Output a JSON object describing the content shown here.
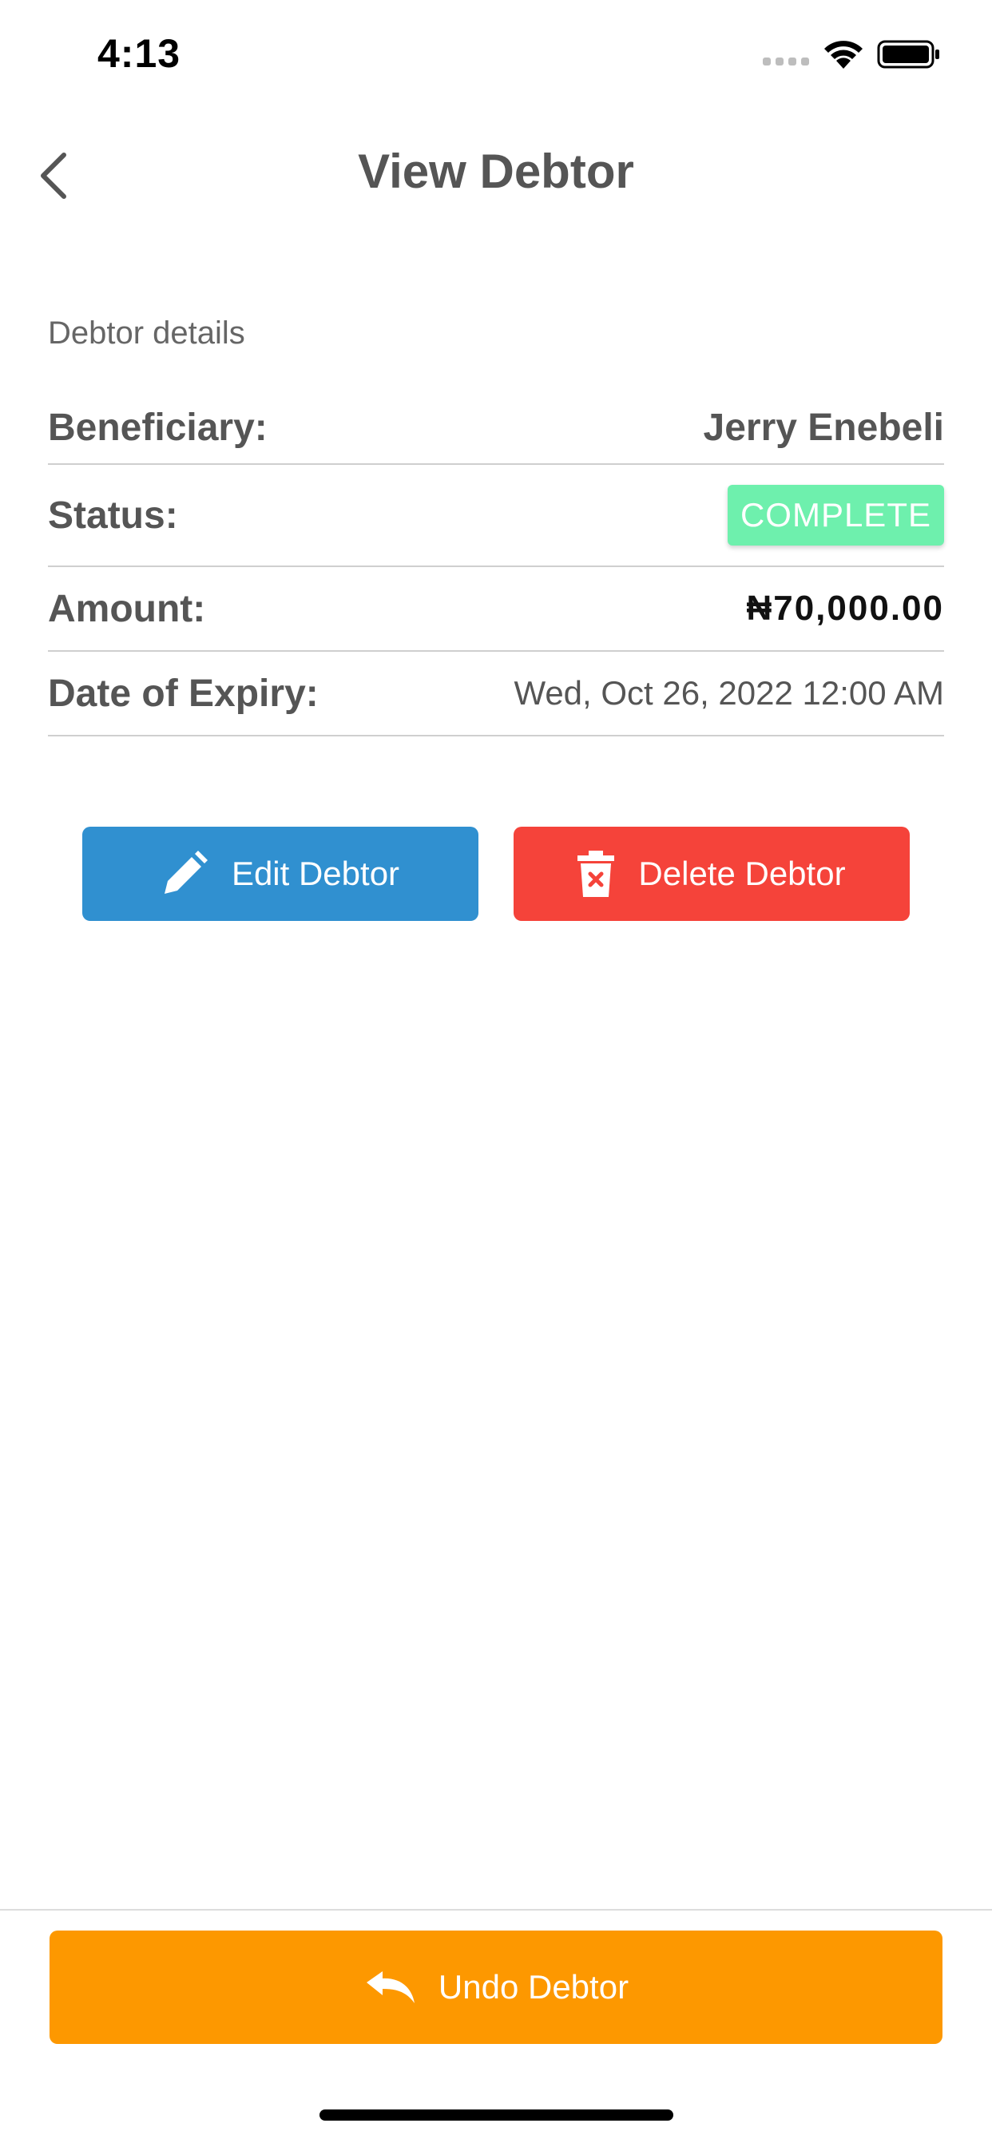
{
  "status_bar": {
    "time": "4:13"
  },
  "header": {
    "title": "View Debtor"
  },
  "details": {
    "section_label": "Debtor details",
    "beneficiary": {
      "label": "Beneficiary:",
      "value": "Jerry Enebeli"
    },
    "status": {
      "label": "Status:",
      "value": "COMPLETE"
    },
    "amount": {
      "label": "Amount:",
      "value": "₦70,000.00"
    },
    "expiry": {
      "label": "Date of Expiry:",
      "value": "Wed, Oct 26, 2022 12:00 AM"
    }
  },
  "actions": {
    "edit_label": "Edit Debtor",
    "delete_label": "Delete Debtor",
    "undo_label": "Undo Debtor"
  },
  "colors": {
    "edit": "#3090d0",
    "delete": "#f5433a",
    "undo": "#fd9800",
    "status_complete": "#6ef0ad"
  },
  "icons": {
    "back": "chevron-left-icon",
    "edit": "pencil-icon",
    "delete": "trash-icon",
    "undo": "undo-icon"
  }
}
